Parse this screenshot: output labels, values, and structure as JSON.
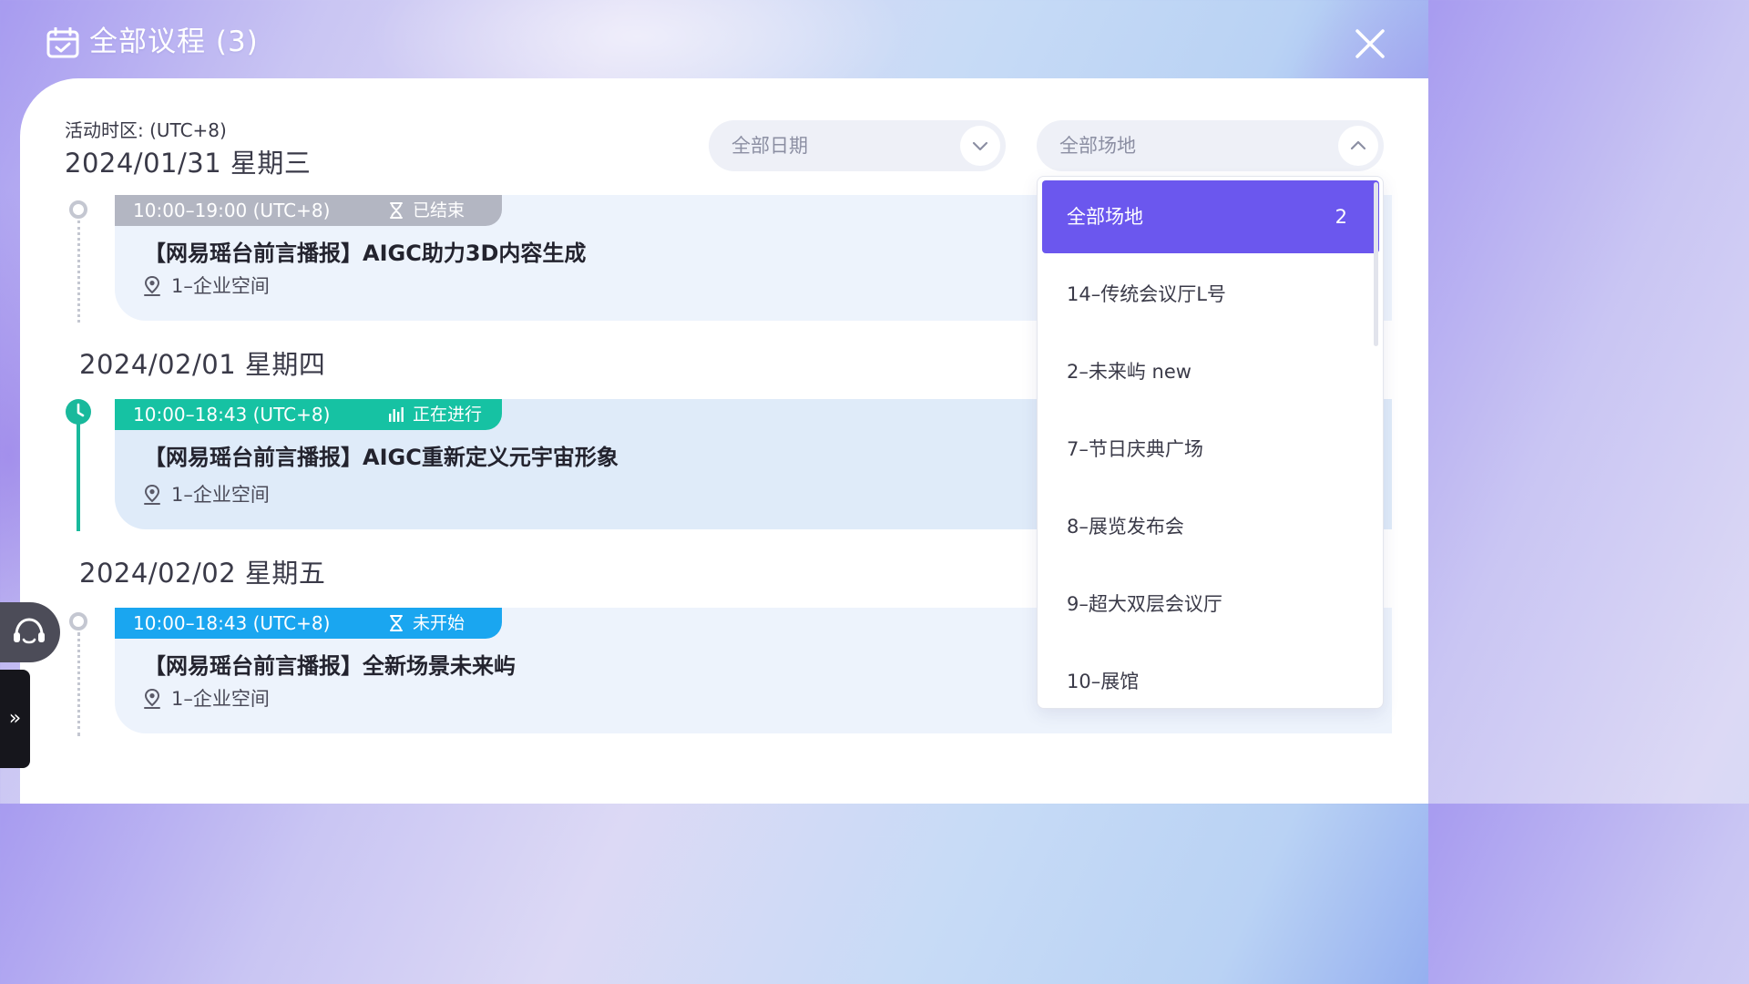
{
  "header": {
    "title": "全部议程 (3)",
    "calendar_icon": "calendar-check-icon",
    "close_icon": "close-icon"
  },
  "timezone_label": "活动时区: (UTC+8)",
  "filters": {
    "date_select": {
      "value": "全部日期",
      "icon": "chevron-down-icon"
    },
    "venue_select": {
      "value": "全部场地",
      "icon": "chevron-up-icon",
      "expanded": true
    }
  },
  "days": [
    {
      "date": "2024/01/31 星期三",
      "sessions": [
        {
          "time": "10:00–19:00 (UTC+8)",
          "status": "已结束",
          "status_icon": "hourglass-icon",
          "title": "【网易瑶台前言播报】AIGC助力3D内容生成",
          "location": "1–企业空间"
        }
      ]
    },
    {
      "date": "2024/02/01 星期四",
      "sessions": [
        {
          "time": "10:00–18:43 (UTC+8)",
          "status": "正在进行",
          "status_icon": "live-bars-icon",
          "title": "【网易瑶台前言播报】AIGC重新定义元宇宙形象",
          "location": "1–企业空间"
        }
      ]
    },
    {
      "date": "2024/02/02 星期五",
      "sessions": [
        {
          "time": "10:00–18:43 (UTC+8)",
          "status": "未开始",
          "status_icon": "hourglass-icon",
          "title": "【网易瑶台前言播报】全新场景未来屿",
          "location": "1–企业空间"
        }
      ]
    }
  ],
  "venue_dropdown": {
    "options": [
      {
        "label": "全部场地",
        "count": "2",
        "selected": true
      },
      {
        "label": "14–传统会议厅L号"
      },
      {
        "label": "2–未来屿 new"
      },
      {
        "label": "7–节日庆典广场"
      },
      {
        "label": "8–展览发布会"
      },
      {
        "label": "9–超大双层会议厅"
      },
      {
        "label": "10–展馆"
      }
    ]
  },
  "floating": {
    "support_icon": "headset-icon",
    "expand_label": "»"
  },
  "colors": {
    "accent": "#6b57ee",
    "live": "#16c2a3",
    "upcoming": "#1aa6f0",
    "ended": "#b3b6c2"
  }
}
